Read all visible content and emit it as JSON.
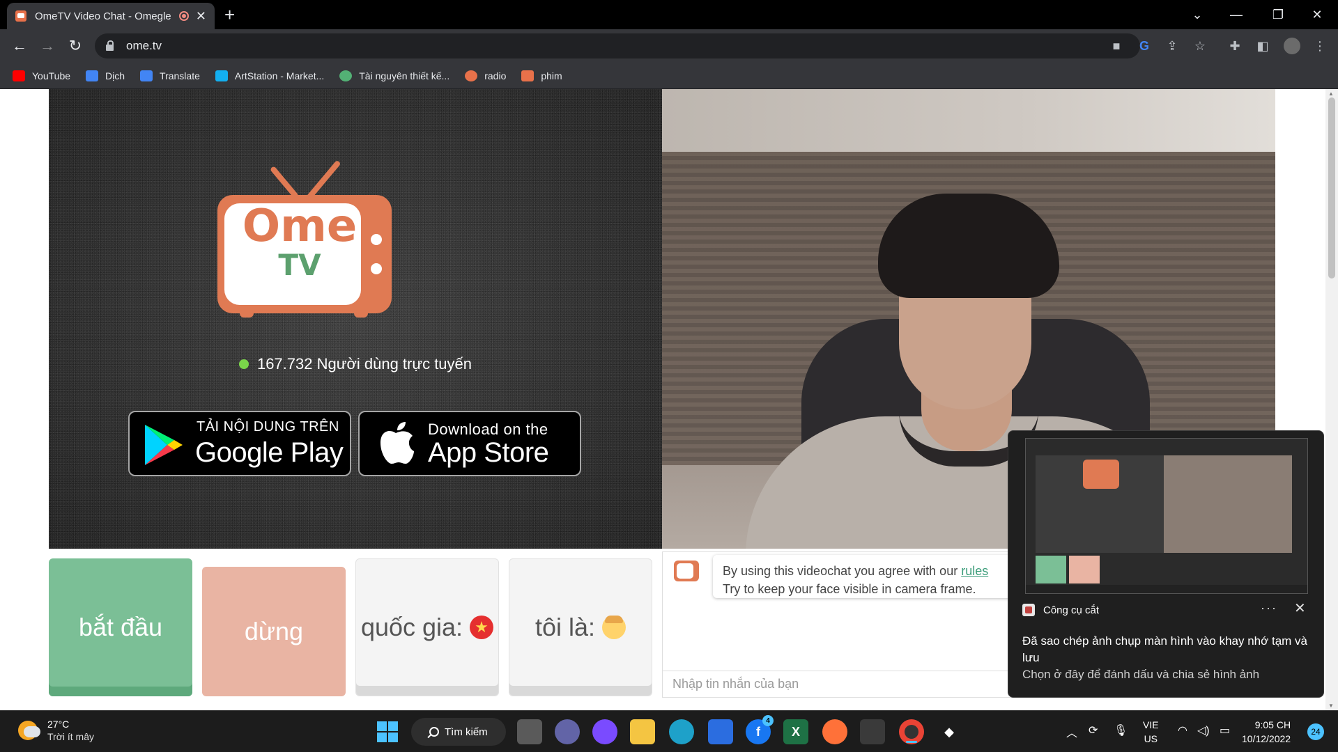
{
  "browser": {
    "tab_title": "OmeTV Video Chat - Omegle",
    "tab_close": "✕",
    "new_tab": "+",
    "url": "ome.tv",
    "window_controls": {
      "minimize": "—",
      "maximize": "❐",
      "close": "✕",
      "dropdown": "⌄"
    }
  },
  "bookmarks": [
    {
      "label": "YouTube",
      "color": "#ff0000"
    },
    {
      "label": "Dịch",
      "color": "#4285f4"
    },
    {
      "label": "Translate",
      "color": "#4285f4"
    },
    {
      "label": "ArtStation - Market...",
      "color": "#13aff0"
    },
    {
      "label": "Tài nguyên thiết kế...",
      "color": "#53b175"
    },
    {
      "label": "radio",
      "color": "#e8714a"
    },
    {
      "label": "phim",
      "color": "#e8714a"
    }
  ],
  "logo": {
    "line1": "Ome",
    "line2": "TV"
  },
  "online_count": "167.732 Người dùng trực tuyến",
  "stores": {
    "google": {
      "small": "TẢI NỘI DUNG TRÊN",
      "big": "Google Play"
    },
    "apple": {
      "small": "Download on the",
      "big": "App Store"
    }
  },
  "controls": {
    "start": "bắt đầu",
    "stop": "dừng",
    "country": "quốc gia:",
    "gender": "tôi là:"
  },
  "chat": {
    "message_prefix": "By using this videochat you agree with our ",
    "rules_link": "rules",
    "message_line2": "Try to keep your face visible in camera frame.",
    "input_placeholder": "Nhập tin nhắn của bạn"
  },
  "toast": {
    "app_name": "Công cụ cắt",
    "more": "···",
    "close": "✕",
    "message": "Đã sao chép ảnh chụp màn hình vào khay nhớ tạm và lưu",
    "hint": "Chọn ở đây để đánh dấu và chia sẻ hình ảnh"
  },
  "taskbar": {
    "temperature": "27°C",
    "weather": "Trời ít mây",
    "search": "Tìm kiếm",
    "lang_top": "VIE",
    "lang_bottom": "US",
    "time": "9:05 CH",
    "date": "10/12/2022",
    "notif_count": "24",
    "facebook_badge": "4"
  },
  "colors": {
    "accent_orange": "#e07a53",
    "accent_green": "#7bbf96",
    "online_dot": "#7ad54a",
    "stop_pink": "#e9b4a3"
  }
}
